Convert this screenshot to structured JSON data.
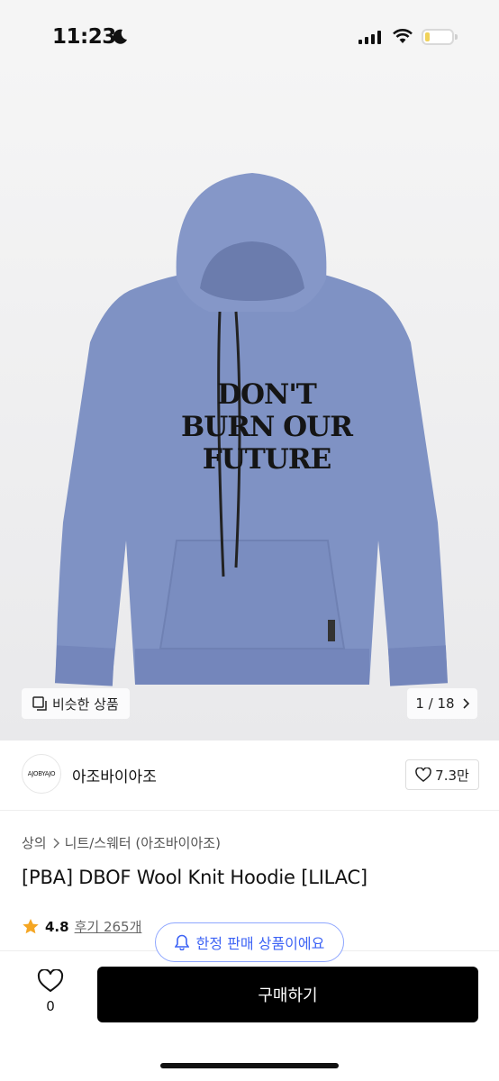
{
  "status_bar": {
    "time": "11:23"
  },
  "hero": {
    "similar_label": "비슷한 상품",
    "page_counter": "1 / 18",
    "graphic_text_line1": "DON'T",
    "graphic_text_line2": "BURN OUR",
    "graphic_text_line3": "FUTURE",
    "product_color": "#7f92c4"
  },
  "brand": {
    "logo_text": "AJOBYAJO",
    "name": "아조바이아조",
    "likes": "7.3만"
  },
  "breadcrumb": {
    "category": "상의",
    "subcategory": "니트/스웨터 (아조바이아조)"
  },
  "product": {
    "title": "[PBA] DBOF Wool Knit Hoodie [LILAC]"
  },
  "rating": {
    "score": "4.8",
    "reviews": "후기 265개"
  },
  "limited": {
    "label": "한정 판매 상품이에요"
  },
  "bottom": {
    "wish_count": "0",
    "buy_label": "구매하기"
  },
  "colors": {
    "accent_blue": "#3d63f5",
    "star": "#f5a623",
    "button_bg": "#000000"
  }
}
